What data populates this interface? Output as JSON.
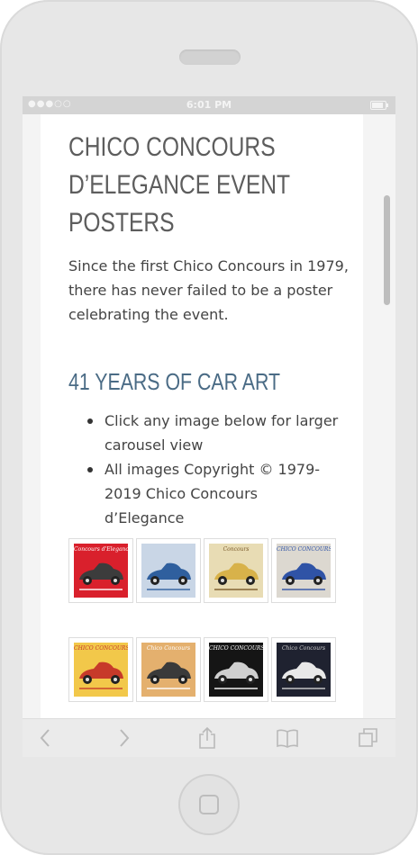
{
  "status_bar": {
    "signal": "●●●○○",
    "time": "6:01 PM"
  },
  "page": {
    "title_lines": [
      "CHICO CONCOURS",
      "D’ELEGANCE EVENT",
      "POSTERS"
    ],
    "intro": "Since the first Chico Concours in 1979, there has never failed to be a poster celebrating the event.",
    "subheading": "41 YEARS OF CAR ART",
    "bullets": [
      "Click any image below for larger carousel view",
      "All images Copyright © 1979-2019 Chico Concours d’Elegance"
    ]
  },
  "posters_row1": [
    {
      "caption": "Concours d'Elegance",
      "bg": "#d9202c",
      "car": "#3c3c3c",
      "text": "#ffffff"
    },
    {
      "caption": "",
      "bg": "#c9d6e6",
      "car": "#2f5f9e",
      "text": "#2f5f9e"
    },
    {
      "caption": "Concours",
      "bg": "#e8dcb4",
      "car": "#d8b24a",
      "text": "#7a5a2a"
    },
    {
      "caption": "CHICO CONCOURS",
      "bg": "#dcd8d0",
      "car": "#2f53a6",
      "text": "#2f53a6"
    }
  ],
  "posters_row2": [
    {
      "caption": "CHICO CONCOURS",
      "bg": "#f2c84a",
      "car": "#c73a2a",
      "text": "#c73a2a"
    },
    {
      "caption": "Chico Concours",
      "bg": "#e4b06e",
      "car": "#3a3a3a",
      "text": "#ffffff"
    },
    {
      "caption": "CHICO CONCOURS",
      "bg": "#151515",
      "car": "#cfcfcf",
      "text": "#ffffff"
    },
    {
      "caption": "Chico Concours",
      "bg": "#1f2230",
      "car": "#e8e8e8",
      "text": "#cfcfcf"
    }
  ],
  "colors": {
    "title": "#5d5d5d",
    "subheading": "#4a6b85",
    "body_text": "#444444"
  },
  "toolbar": {
    "icons": [
      "back-icon",
      "forward-icon",
      "share-icon",
      "bookmarks-icon",
      "tabs-icon"
    ]
  }
}
